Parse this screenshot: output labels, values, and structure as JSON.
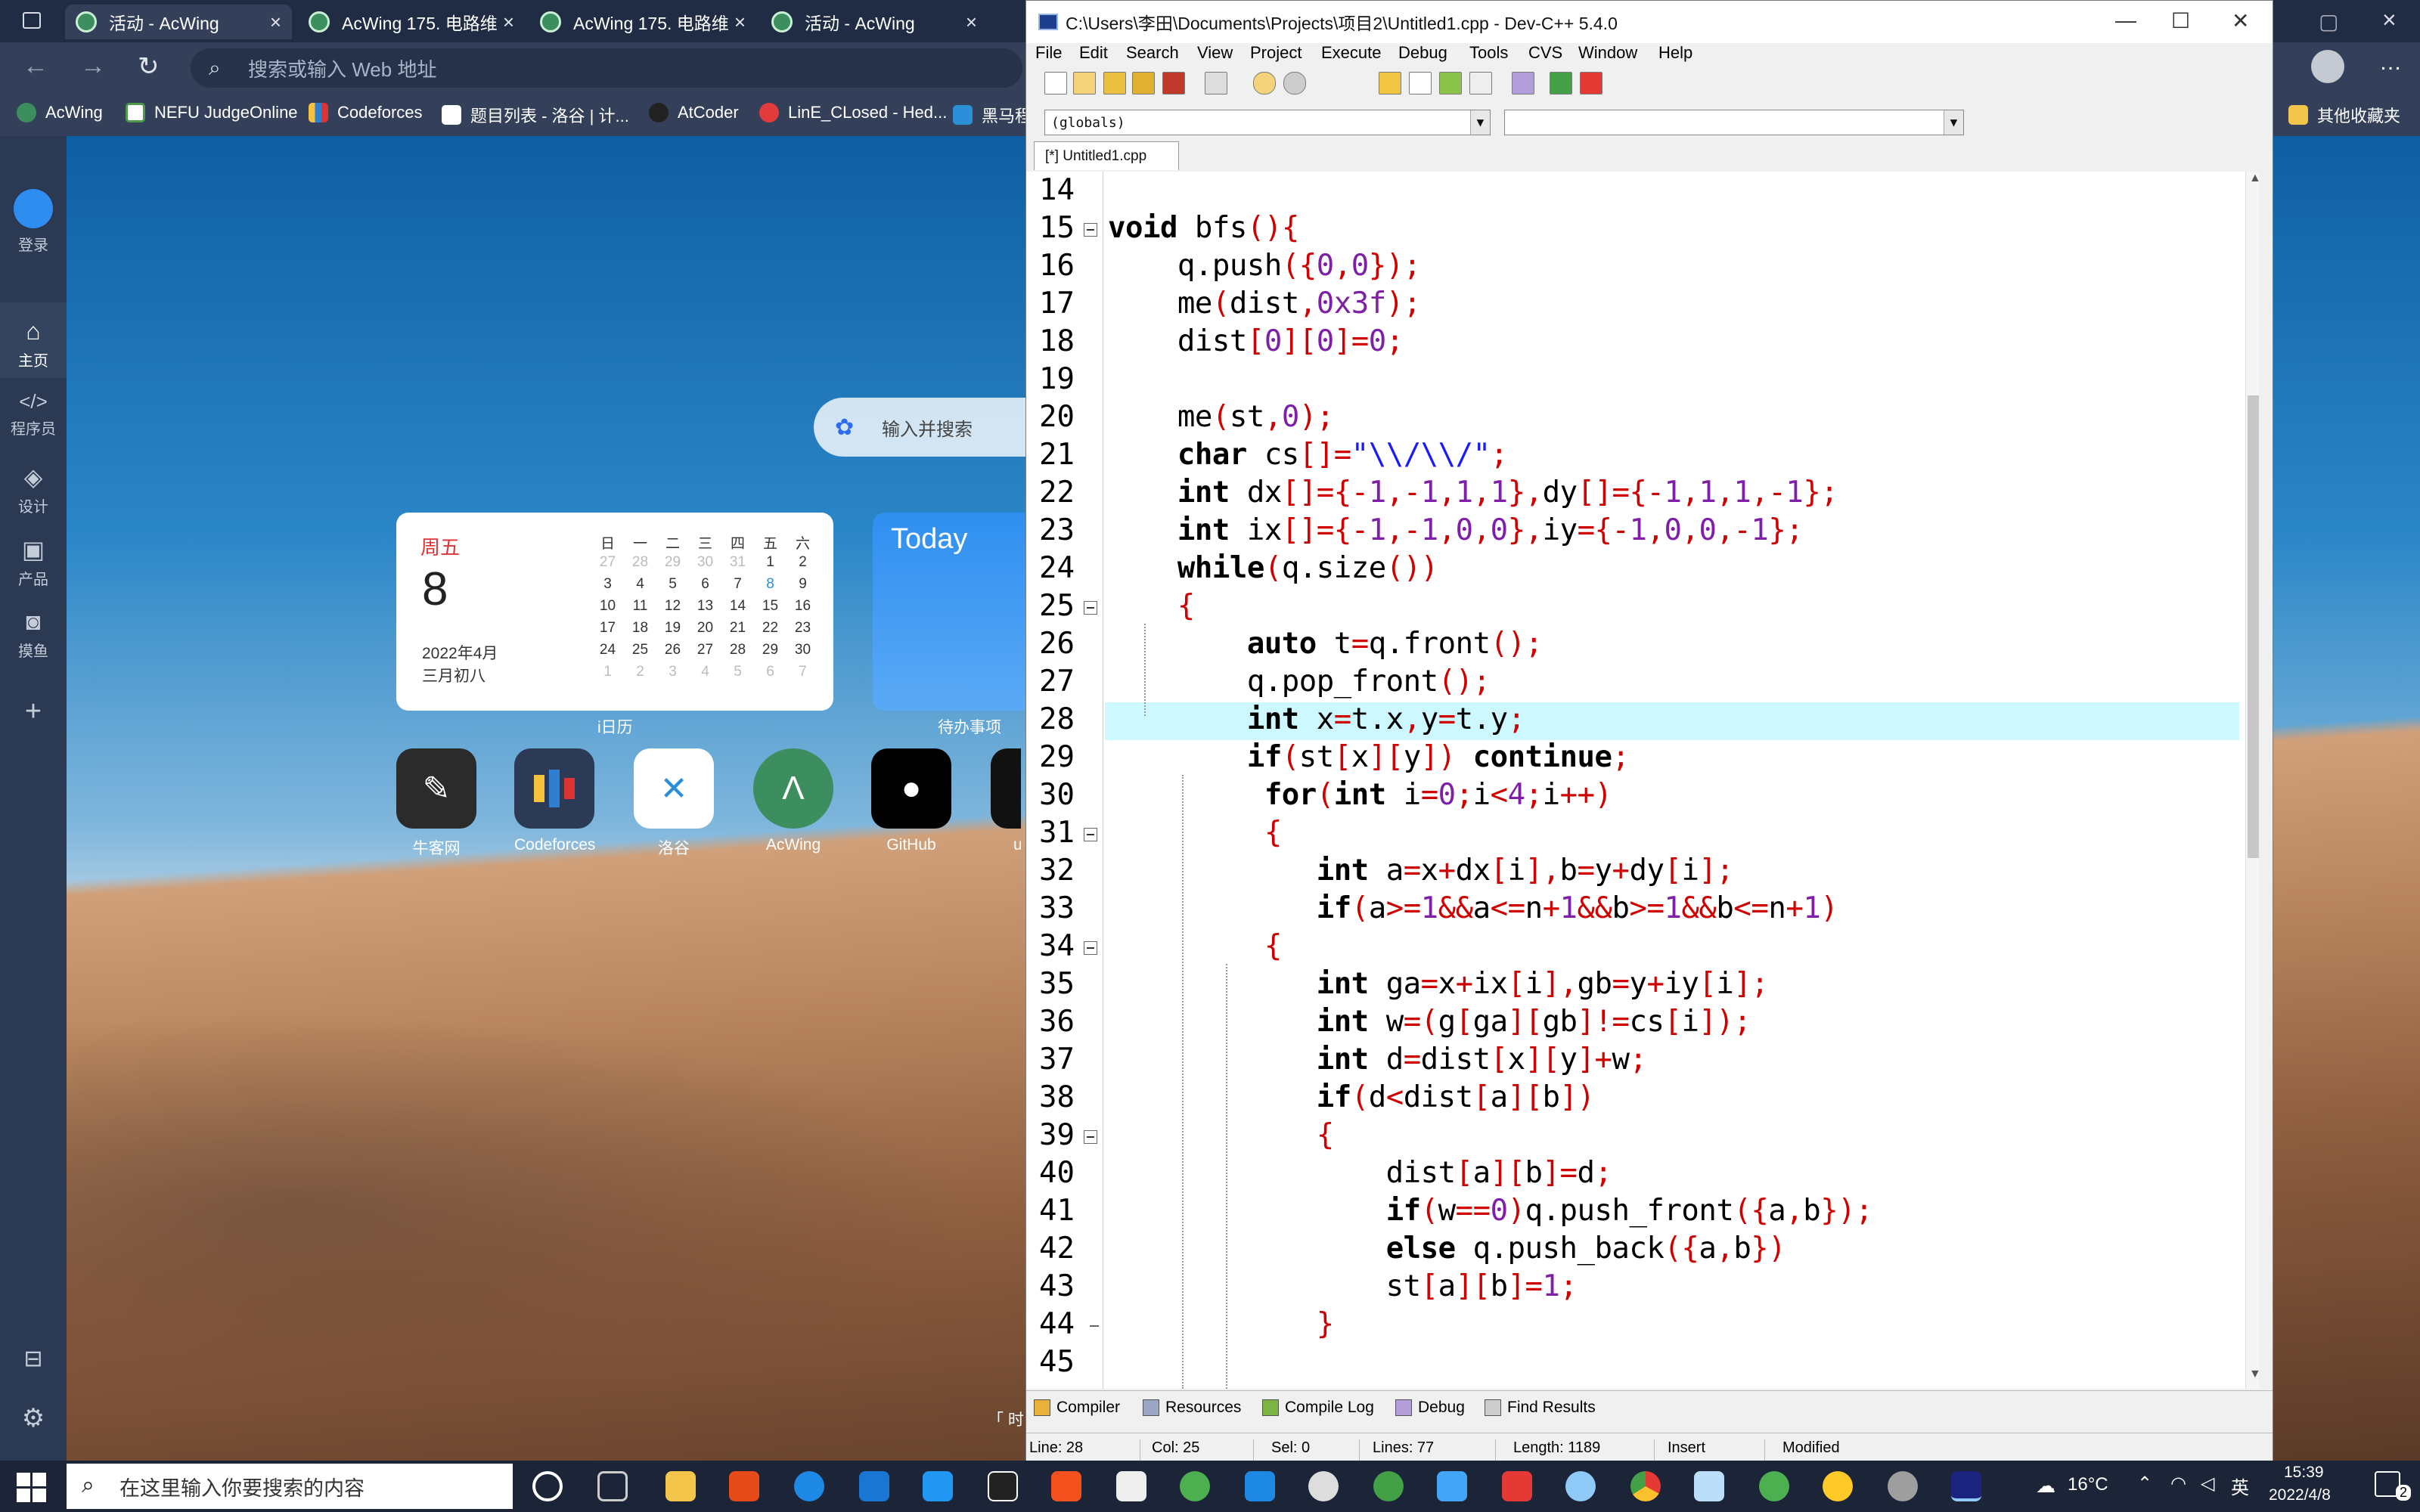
{
  "browser": {
    "tabs": [
      {
        "label": "活动 - AcWing"
      },
      {
        "label": "AcWing 175. 电路维"
      },
      {
        "label": "AcWing 175. 电路维"
      },
      {
        "label": "活动 - AcWing"
      }
    ],
    "address_placeholder": "搜索或输入 Web 地址",
    "profile_label": "登录",
    "bookmarks": [
      "AcWing",
      "NEFU JudgeOnline",
      "Codeforces",
      "题目列表 - 洛谷 | 计...",
      "AtCoder",
      "LinE_CLosed - Hed...",
      "黑马程"
    ],
    "other_bookmarks": "其他收藏夹"
  },
  "side_nav": {
    "login": "登录",
    "items": [
      {
        "label": "主页",
        "icon": "home-icon"
      },
      {
        "label": "程序员",
        "icon": "code-icon"
      },
      {
        "label": "设计",
        "icon": "cube-icon"
      },
      {
        "label": "产品",
        "icon": "bag-icon"
      },
      {
        "label": "摸鱼",
        "icon": "gamepad-icon"
      }
    ]
  },
  "newtab": {
    "search_placeholder": "输入并搜索",
    "calendar": {
      "weekday": "周五",
      "day": "8",
      "year_month": "2022年4月",
      "lunar": "三月初八",
      "header": [
        "日",
        "一",
        "二",
        "三",
        "四",
        "五",
        "六"
      ],
      "weeks": [
        [
          "27",
          "28",
          "29",
          "30",
          "31",
          "1",
          "2"
        ],
        [
          "3",
          "4",
          "5",
          "6",
          "7",
          "8",
          "9"
        ],
        [
          "10",
          "11",
          "12",
          "13",
          "14",
          "15",
          "16"
        ],
        [
          "17",
          "18",
          "19",
          "20",
          "21",
          "22",
          "23"
        ],
        [
          "24",
          "25",
          "26",
          "27",
          "28",
          "29",
          "30"
        ],
        [
          "1",
          "2",
          "3",
          "4",
          "5",
          "6",
          "7"
        ]
      ],
      "caption": "i日历"
    },
    "today_card": {
      "title": "Today",
      "caption": "待办事项"
    },
    "apps": [
      "牛客网",
      "Codeforces",
      "洛谷",
      "AcWing",
      "GitHub",
      "u"
    ],
    "bottom_hint": "「 时"
  },
  "devcpp": {
    "title": "C:\\Users\\李田\\Documents\\Projects\\项目2\\Untitled1.cpp - Dev-C++ 5.4.0",
    "menu": [
      "File",
      "Edit",
      "Search",
      "View",
      "Project",
      "Execute",
      "Debug",
      "Tools",
      "CVS",
      "Window",
      "Help"
    ],
    "scope_combo": "(globals)",
    "file_tab": "[*] Untitled1.cpp",
    "bottom_tabs": [
      "Compiler",
      "Resources",
      "Compile Log",
      "Debug",
      "Find Results"
    ],
    "status": {
      "line": "Line:    28",
      "col": "Col:    25",
      "sel": "Sel:    0",
      "lines": "Lines:   77",
      "length": "Length:  1189",
      "mode": "Insert",
      "state": "Modified"
    },
    "code": [
      {
        "n": "14",
        "t": ""
      },
      {
        "n": "15",
        "t": "void bfs(){"
      },
      {
        "n": "16",
        "t": "    q.push({0,0});"
      },
      {
        "n": "17",
        "t": "    me(dist,0x3f);"
      },
      {
        "n": "18",
        "t": "    dist[0][0]=0;"
      },
      {
        "n": "19",
        "t": ""
      },
      {
        "n": "20",
        "t": "    me(st,0);"
      },
      {
        "n": "21",
        "t": "    char cs[]=\"\\\\/\\\\/\";"
      },
      {
        "n": "22",
        "t": "    int dx[]={-1,-1,1,1},dy[]={-1,1,1,-1};"
      },
      {
        "n": "23",
        "t": "    int ix[]={-1,-1,0,0},iy={-1,0,0,-1};"
      },
      {
        "n": "24",
        "t": "    while(q.size())"
      },
      {
        "n": "25",
        "t": "    {"
      },
      {
        "n": "26",
        "t": "        auto t=q.front();"
      },
      {
        "n": "27",
        "t": "        q.pop_front();"
      },
      {
        "n": "28",
        "t": "        int x=t.x,y=t.y;"
      },
      {
        "n": "29",
        "t": "        if(st[x][y]) continue;"
      },
      {
        "n": "30",
        "t": "         for(int i=0;i<4;i++)"
      },
      {
        "n": "31",
        "t": "         {"
      },
      {
        "n": "32",
        "t": "            int a=x+dx[i],b=y+dy[i];"
      },
      {
        "n": "33",
        "t": "            if(a>=1&&a<=n+1&&b>=1&&b<=n+1)"
      },
      {
        "n": "34",
        "t": "         {"
      },
      {
        "n": "35",
        "t": "            int ga=x+ix[i],gb=y+iy[i];"
      },
      {
        "n": "36",
        "t": "            int w=(g[ga][gb]!=cs[i]);"
      },
      {
        "n": "37",
        "t": "            int d=dist[x][y]+w;"
      },
      {
        "n": "38",
        "t": "            if(d<dist[a][b])"
      },
      {
        "n": "39",
        "t": "            {"
      },
      {
        "n": "40",
        "t": "                dist[a][b]=d;"
      },
      {
        "n": "41",
        "t": "                if(w==0)q.push_front({a,b});"
      },
      {
        "n": "42",
        "t": "                else q.push_back({a,b})"
      },
      {
        "n": "43",
        "t": "                st[a][b]=1;"
      },
      {
        "n": "44",
        "t": "            }"
      },
      {
        "n": "45",
        "t": ""
      }
    ],
    "current_line": "28"
  },
  "taskbar": {
    "search_placeholder": "在这里输入你要搜索的内容",
    "weather": "16°C",
    "ime": "英",
    "time": "15:39",
    "date": "2022/4/8",
    "notifications": "2"
  }
}
